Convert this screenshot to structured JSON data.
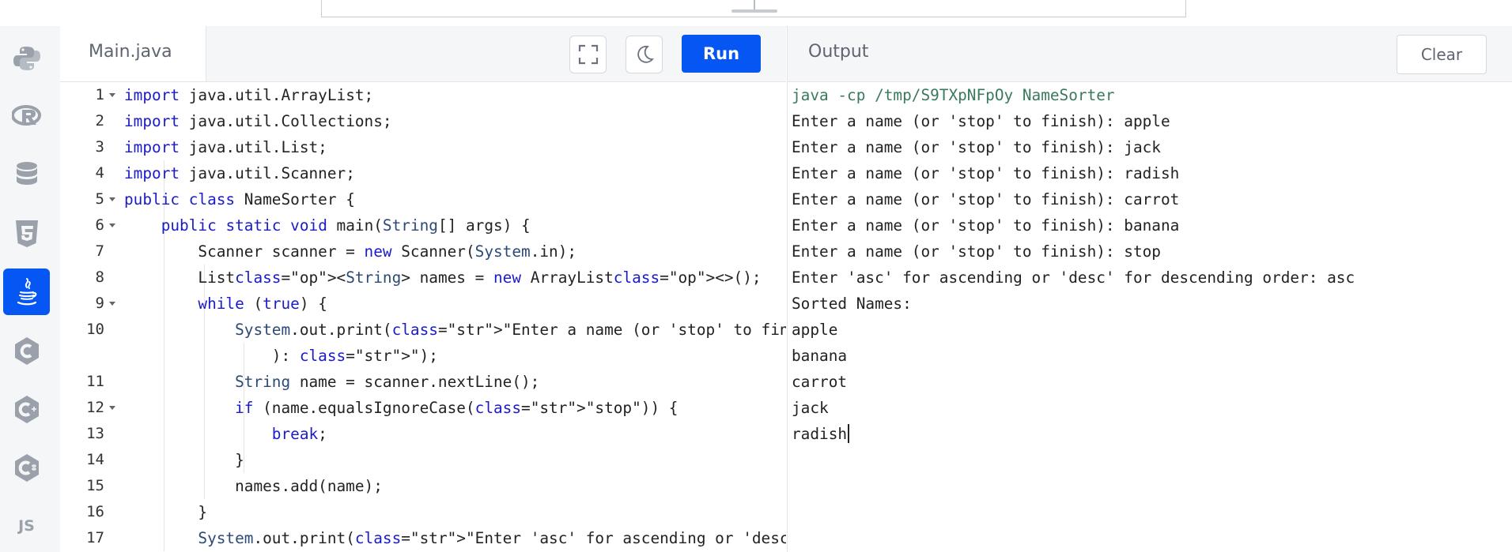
{
  "editor": {
    "filename": "Main.java",
    "run_label": "Run",
    "fullscreen_icon": "fullscreen-icon",
    "theme_icon": "moon-icon"
  },
  "sidebar": {
    "items": [
      {
        "name": "python",
        "icon": "python-icon"
      },
      {
        "name": "r",
        "icon": "r-icon"
      },
      {
        "name": "sql",
        "icon": "database-icon"
      },
      {
        "name": "html",
        "icon": "html5-icon"
      },
      {
        "name": "java",
        "icon": "java-icon",
        "active": true
      },
      {
        "name": "c",
        "icon": "c-icon"
      },
      {
        "name": "cpp",
        "icon": "cpp-icon"
      },
      {
        "name": "csharp",
        "icon": "csharp-icon"
      },
      {
        "name": "javascript",
        "icon": "js-icon",
        "label": "JS"
      }
    ]
  },
  "code": {
    "line_numbers": [
      "1",
      "2",
      "3",
      "4",
      "5",
      "6",
      "7",
      "8",
      "9",
      "10",
      "11",
      "12",
      "13",
      "14",
      "15",
      "16",
      "17"
    ],
    "lines": [
      "import java.util.ArrayList;",
      "import java.util.Collections;",
      "import java.util.List;",
      "import java.util.Scanner;",
      "public class NameSorter {",
      "    public static void main(String[] args) {",
      "        Scanner scanner = new Scanner(System.in);",
      "        List<String> names = new ArrayList<>();",
      "        while (true) {",
      "            System.out.print(\"Enter a name (or 'stop' to finish",
      "                ): \");",
      "            String name = scanner.nextLine();",
      "            if (name.equalsIgnoreCase(\"stop\")) {",
      "                break;",
      "            }",
      "            names.add(name);",
      "        }",
      "        System.out.print(\"Enter 'asc' for ascending or 'desc'"
    ]
  },
  "output": {
    "title": "Output",
    "clear_label": "Clear",
    "lines": [
      "java -cp /tmp/S9TXpNFpOy NameSorter",
      "Enter a name (or 'stop' to finish): apple",
      "Enter a name (or 'stop' to finish): jack",
      "Enter a name (or 'stop' to finish): radish",
      "Enter a name (or 'stop' to finish): carrot",
      "Enter a name (or 'stop' to finish): banana",
      "Enter a name (or 'stop' to finish): stop",
      "Enter 'asc' for ascending or 'desc' for descending order: asc",
      "Sorted Names:",
      "apple",
      "banana",
      "carrot",
      "jack",
      "radish"
    ]
  },
  "colors": {
    "accent": "#0556f3",
    "keyword": "#1b1bc9",
    "string": "#0f7a0f",
    "command": "#3a7a5c"
  }
}
